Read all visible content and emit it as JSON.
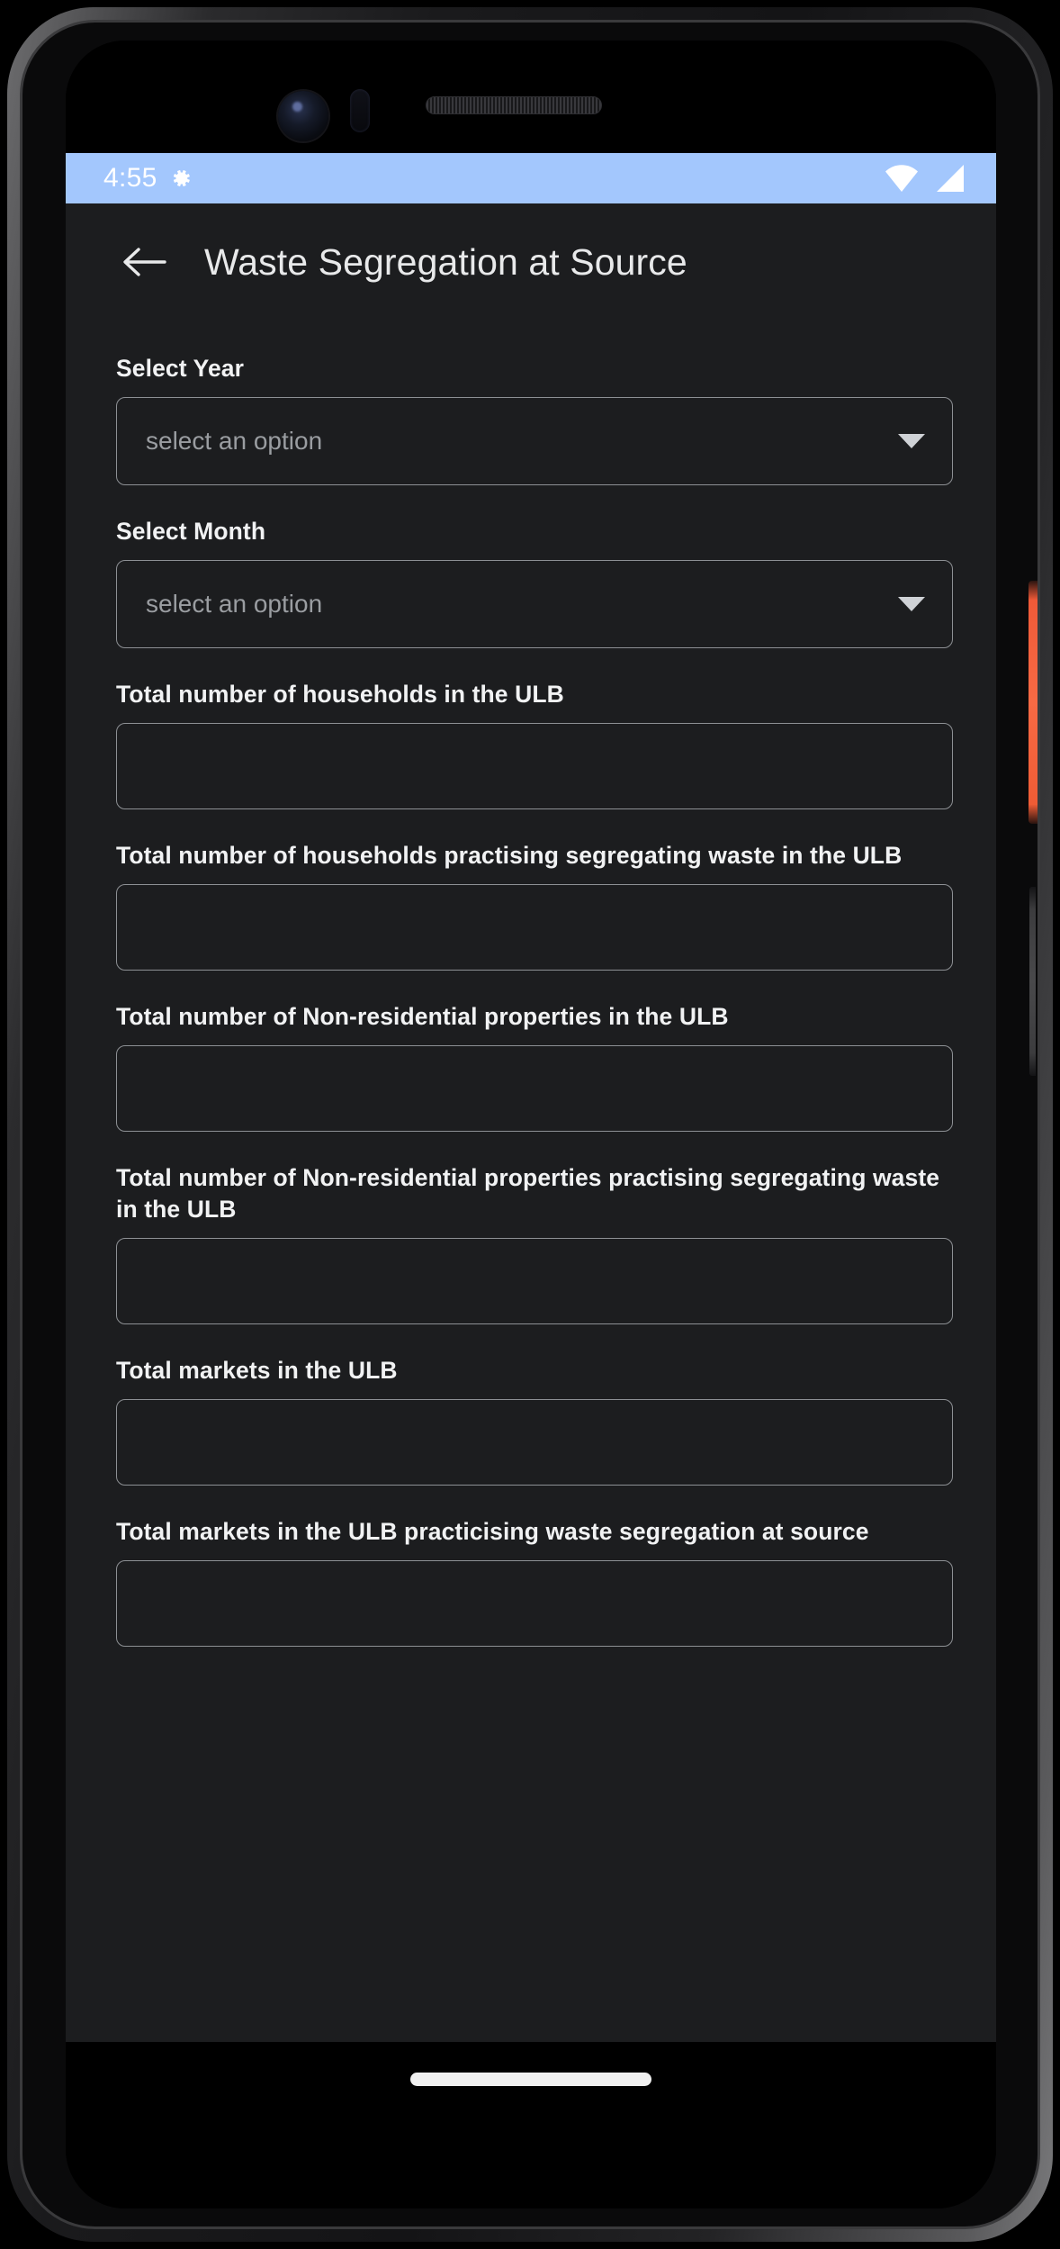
{
  "status_bar": {
    "time": "4:55",
    "icons": [
      "gear-icon",
      "wifi-icon",
      "cellular-signal-icon"
    ],
    "background_color": "#a3c7fd",
    "foreground_color": "#ffffff"
  },
  "app_bar": {
    "back_icon": "arrow-left-icon",
    "title": "Waste Segregation at Source"
  },
  "theme": {
    "background": "#1c1d1f",
    "text_primary": "#f1f2f3",
    "text_placeholder": "#9a9da1",
    "border": "#8d9094"
  },
  "form": {
    "fields": [
      {
        "label": "Select Year",
        "type": "select",
        "value": "",
        "placeholder": "select an option",
        "name": "select-year"
      },
      {
        "label": "Select Month",
        "type": "select",
        "value": "",
        "placeholder": "select an option",
        "name": "select-month"
      },
      {
        "label": "Total number of households in the ULB",
        "type": "text",
        "value": "",
        "placeholder": "",
        "name": "total-households"
      },
      {
        "label": "Total number of households practising segregating waste in the ULB",
        "type": "text",
        "value": "",
        "placeholder": "",
        "name": "households-segregating"
      },
      {
        "label": "Total number of Non-residential properties in the ULB",
        "type": "text",
        "value": "",
        "placeholder": "",
        "name": "non-residential-properties"
      },
      {
        "label": "Total number of Non-residential properties practising segregating waste in the ULB",
        "type": "text",
        "value": "",
        "placeholder": "",
        "name": "non-residential-segregating"
      },
      {
        "label": "Total markets in the ULB",
        "type": "text",
        "value": "",
        "placeholder": "",
        "name": "total-markets"
      },
      {
        "label": "Total markets in the ULB practicising waste segregation at source",
        "type": "text",
        "value": "",
        "placeholder": "",
        "name": "markets-segregating"
      }
    ]
  },
  "nav_bar": {
    "gesture_handle": "home-gesture-pill"
  }
}
